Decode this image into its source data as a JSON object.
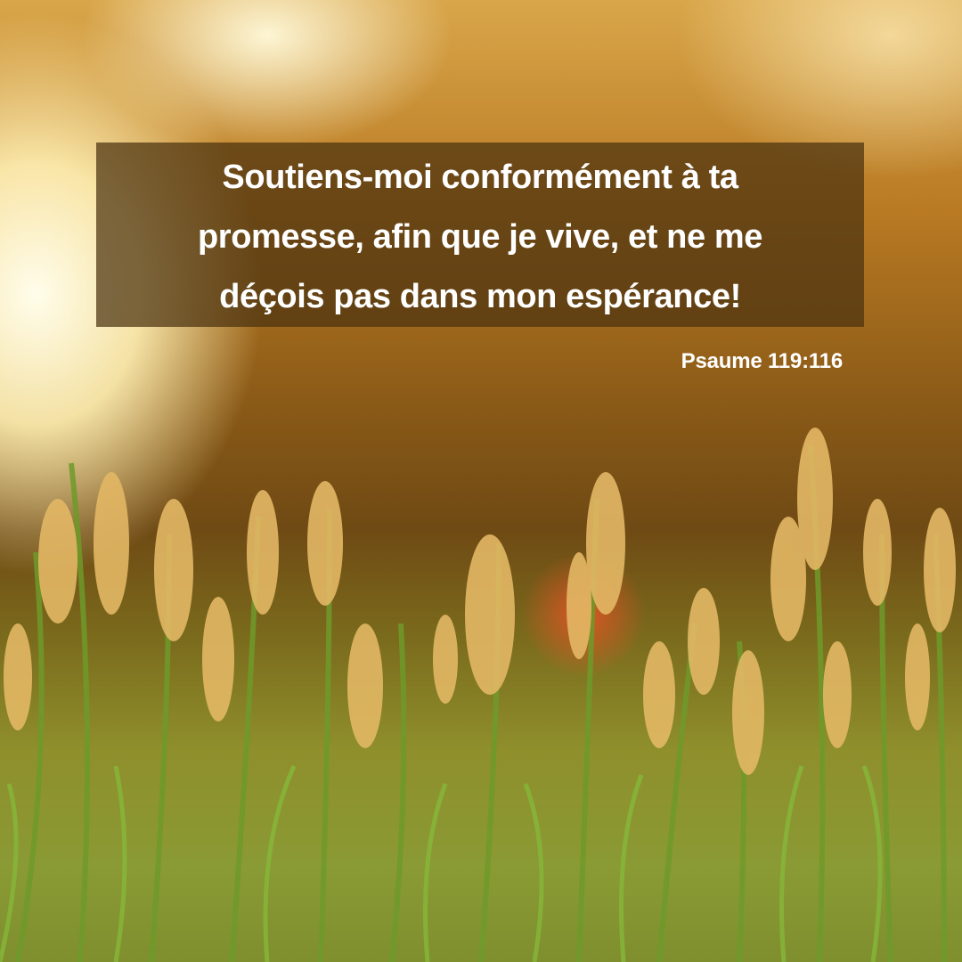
{
  "verse": {
    "lines": [
      "Soutiens-moi conformément à ta",
      "promesse, afin que je vive, et ne me",
      "déçois pas dans mon espérance!"
    ],
    "reference": "Psaume 119:116"
  },
  "colors": {
    "overlay": "#4b320f",
    "text": "#ffffff"
  }
}
